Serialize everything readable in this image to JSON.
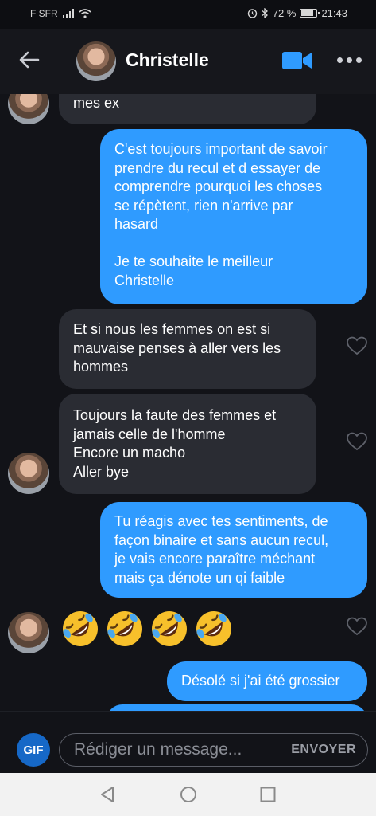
{
  "status": {
    "carrier": "F SFR",
    "battery": "72 %",
    "time": "21:43"
  },
  "header": {
    "contact_name": "Christelle"
  },
  "messages": [
    {
      "from": "them",
      "lines": [
        "mes ex"
      ]
    },
    {
      "from": "me",
      "lines": [
        "C'est toujours important de savoir",
        "prendre du recul et d essayer de",
        "comprendre pourquoi les choses",
        "se répètent, rien n'arrive par",
        "hasard",
        "",
        "Je te souhaite le meilleur",
        "Christelle"
      ]
    },
    {
      "from": "them",
      "lines": [
        "Et si nous les femmes on est si",
        "mauvaise penses à aller vers les",
        "hommes"
      ]
    },
    {
      "from": "them",
      "lines": [
        "Toujours la faute des femmes et",
        "jamais celle de l'homme",
        "Encore un macho",
        "Aller bye"
      ]
    },
    {
      "from": "me",
      "lines": [
        "Tu réagis avec tes sentiments, de",
        "façon binaire et sans aucun recul,",
        "je vais encore paraître méchant",
        "mais ça dénote un qi faible"
      ]
    },
    {
      "from": "them",
      "emoji": "rolling-on-floor-laughing",
      "count": 4
    },
    {
      "from": "me",
      "lines": [
        "Désolé si j'ai été grossier"
      ]
    }
  ],
  "composer": {
    "gif_label": "GIF",
    "placeholder": "Rédiger un message...",
    "send_label": "ENVOYER"
  },
  "colors": {
    "outgoing": "#2f9bff",
    "incoming": "#2a2c33",
    "background": "#121318",
    "video_icon": "#2f9bff"
  }
}
